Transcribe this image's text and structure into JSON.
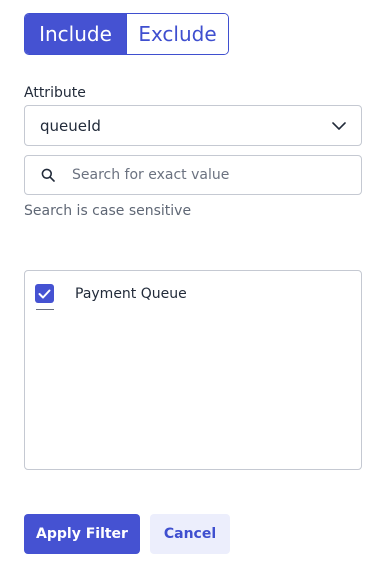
{
  "mode_toggle": {
    "include_label": "Include",
    "exclude_label": "Exclude",
    "selected": "Include"
  },
  "attribute": {
    "label": "Attribute",
    "value": "queueId"
  },
  "search": {
    "placeholder": "Search for exact value",
    "value": "",
    "hint": "Search is case sensitive"
  },
  "values_list": {
    "items": [
      {
        "label": "Payment Queue",
        "checked": true
      }
    ]
  },
  "actions": {
    "apply_label": "Apply Filter",
    "cancel_label": "Cancel"
  },
  "colors": {
    "accent": "#4552d2",
    "secondary_bg": "#eceefc",
    "border": "#c5c9d2",
    "text": "#222b3a",
    "muted_text": "#5f6775"
  },
  "icons": {
    "dropdown": "chevron-down-icon",
    "search": "search-icon",
    "check": "check-icon"
  }
}
